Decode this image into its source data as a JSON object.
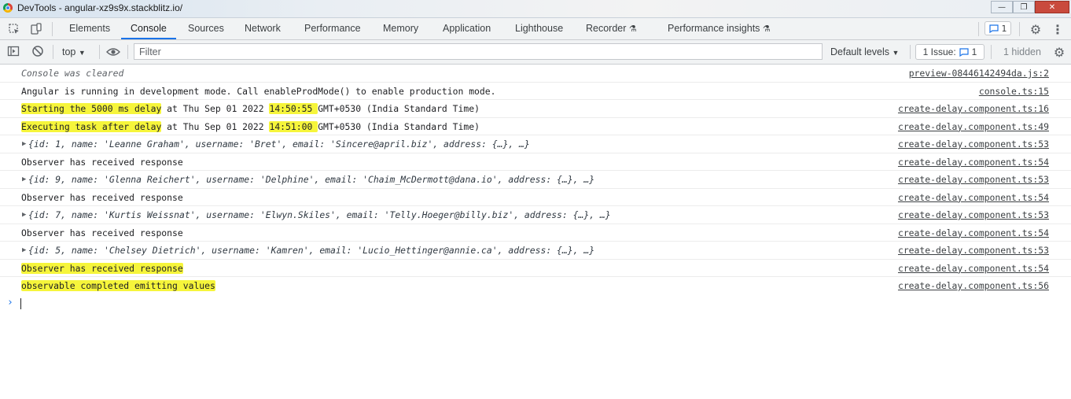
{
  "window": {
    "title": "DevTools - angular-xz9s9x.stackblitz.io/",
    "minimize": "—",
    "maximize": "❐",
    "close": "✕"
  },
  "tabs": [
    {
      "label": "Elements"
    },
    {
      "label": "Console"
    },
    {
      "label": "Sources"
    },
    {
      "label": "Network"
    },
    {
      "label": "Performance"
    },
    {
      "label": "Memory"
    },
    {
      "label": "Application"
    },
    {
      "label": "Lighthouse"
    },
    {
      "label": "Recorder"
    },
    {
      "label": "Performance insights"
    }
  ],
  "active_tab": "Console",
  "messages_badge": "1",
  "toolbar": {
    "context": "top",
    "filter_placeholder": "Filter",
    "levels": "Default levels",
    "issues_label": "1 Issue:",
    "issues_count": "1",
    "hidden": "1 hidden"
  },
  "console": {
    "row0": {
      "text": "Console was cleared",
      "src": "preview-08446142494da.js:2"
    },
    "row1": {
      "text": "Angular is running in development mode. Call enableProdMode() to enable production mode.",
      "src": "console.ts:15"
    },
    "row2": {
      "a": "Starting the 5000 ms delay",
      "b": " at Thu Sep 01 2022 ",
      "c": "14:50:55 ",
      "d": "GMT+0530 (India Standard Time)",
      "src": "create-delay.component.ts:16"
    },
    "row3": {
      "a": "Executing task after delay",
      "b": " at Thu Sep 01 2022 ",
      "c": "14:51:00 ",
      "d": "GMT+0530 (India Standard Time)",
      "src": "create-delay.component.ts:49"
    },
    "row4": {
      "text": "{id: 1, name: 'Leanne Graham', username: 'Bret', email: 'Sincere@april.biz', address: {…}, …}",
      "src": "create-delay.component.ts:53"
    },
    "row5": {
      "text": "Observer has received response",
      "src": "create-delay.component.ts:54"
    },
    "row6": {
      "text": "{id: 9, name: 'Glenna Reichert', username: 'Delphine', email: 'Chaim_McDermott@dana.io', address: {…}, …}",
      "src": "create-delay.component.ts:53"
    },
    "row7": {
      "text": "Observer has received response",
      "src": "create-delay.component.ts:54"
    },
    "row8": {
      "text": "{id: 7, name: 'Kurtis Weissnat', username: 'Elwyn.Skiles', email: 'Telly.Hoeger@billy.biz', address: {…}, …}",
      "src": "create-delay.component.ts:53"
    },
    "row9": {
      "text": "Observer has received response",
      "src": "create-delay.component.ts:54"
    },
    "row10": {
      "text": "{id: 5, name: 'Chelsey Dietrich', username: 'Kamren', email: 'Lucio_Hettinger@annie.ca', address: {…}, …}",
      "src": "create-delay.component.ts:53"
    },
    "row11": {
      "text": "Observer has received response",
      "src": "create-delay.component.ts:54"
    },
    "row12": {
      "text": "observable completed emitting values",
      "src": "create-delay.component.ts:56"
    }
  },
  "colors": {
    "highlight": "#f6f53b",
    "accent": "#1a73e8"
  }
}
